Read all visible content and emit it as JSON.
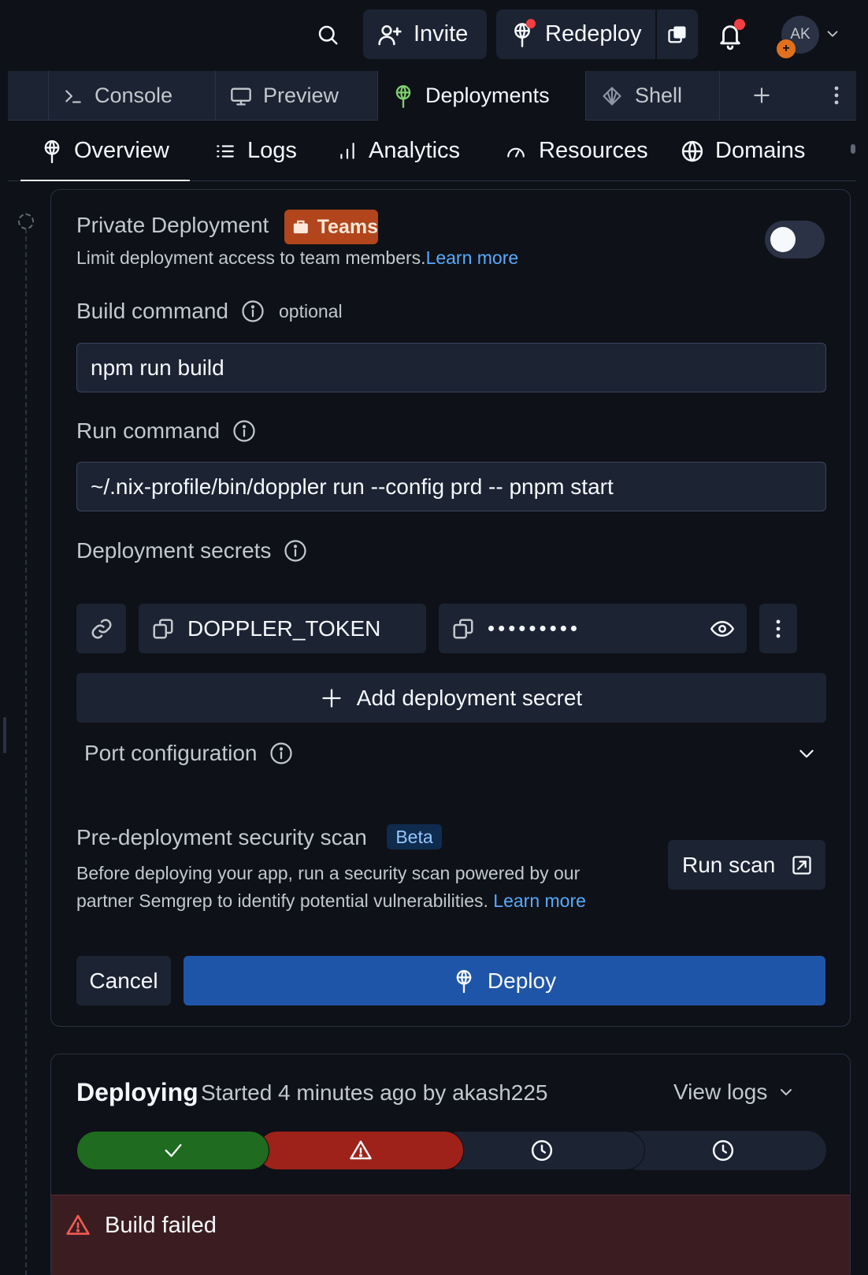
{
  "topbar": {
    "invite_label": "Invite",
    "redeploy_label": "Redeploy",
    "avatar_initials": "AK"
  },
  "tabs": [
    {
      "label": "Console",
      "icon": "terminal-icon",
      "active": false
    },
    {
      "label": "Preview",
      "icon": "monitor-icon",
      "active": false
    },
    {
      "label": "Deployments",
      "icon": "deploy-icon",
      "active": true
    },
    {
      "label": "Shell",
      "icon": "shell-icon",
      "active": false
    }
  ],
  "subnav": [
    {
      "label": "Overview",
      "icon": "deploy-icon",
      "active": true
    },
    {
      "label": "Logs",
      "icon": "list-icon",
      "active": false
    },
    {
      "label": "Analytics",
      "icon": "bar-chart-icon",
      "active": false
    },
    {
      "label": "Resources",
      "icon": "gauge-icon",
      "active": false
    },
    {
      "label": "Domains",
      "icon": "globe-icon",
      "active": false
    }
  ],
  "config": {
    "private": {
      "title": "Private Deployment",
      "badge": "Teams",
      "description": "Limit deployment access to team members.",
      "link": "Learn more",
      "enabled": false
    },
    "build": {
      "label": "Build command",
      "optional": "optional",
      "value": "npm run build"
    },
    "run": {
      "label": "Run command",
      "value": "~/.nix-profile/bin/doppler run --config prd -- pnpm start"
    },
    "secrets": {
      "label": "Deployment secrets",
      "items": [
        {
          "key": "DOPPLER_TOKEN",
          "value_masked": "•••••••••"
        }
      ],
      "add_label": "Add deployment secret"
    },
    "port": {
      "label": "Port configuration"
    },
    "scan": {
      "title": "Pre-deployment security scan",
      "badge": "Beta",
      "description": "Before deploying your app, run a security scan powered by our partner Semgrep to identify potential vulnerabilities.",
      "link": "Learn more",
      "button": "Run scan"
    },
    "cancel_label": "Cancel",
    "deploy_label": "Deploy"
  },
  "deploying": {
    "title": "Deploying",
    "subtitle": "Started 4 minutes ago by akash225",
    "view_logs": "View logs",
    "stages": [
      {
        "status": "success",
        "icon": "check-icon",
        "color": "#1f6b1f"
      },
      {
        "status": "failed",
        "icon": "warning-icon",
        "color": "#9e2219"
      },
      {
        "status": "pending",
        "icon": "clock-icon",
        "color": "#1c2333"
      },
      {
        "status": "pending",
        "icon": "clock-icon",
        "color": "#1c2333"
      }
    ],
    "error": "Build failed"
  },
  "colors": {
    "accent": "#1e55a8",
    "link": "#57abff",
    "teams_badge": "#b2451b",
    "beta_badge": "#0f2b4e",
    "error_banner": "#3b1d21"
  }
}
